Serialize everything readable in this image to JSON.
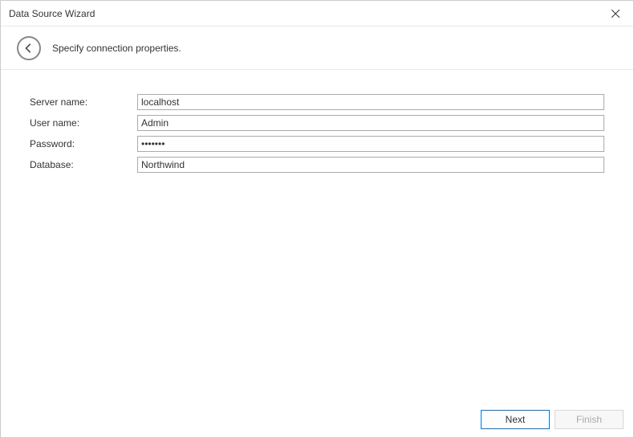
{
  "window": {
    "title": "Data Source Wizard"
  },
  "subheader": {
    "text": "Specify connection properties."
  },
  "form": {
    "server_label": "Server name:",
    "server_value": "localhost",
    "user_label": "User name:",
    "user_value": "Admin",
    "password_label": "Password:",
    "password_value": "•••••••",
    "database_label": "Database:",
    "database_value": "Northwind"
  },
  "footer": {
    "next_label": "Next",
    "finish_label": "Finish"
  }
}
